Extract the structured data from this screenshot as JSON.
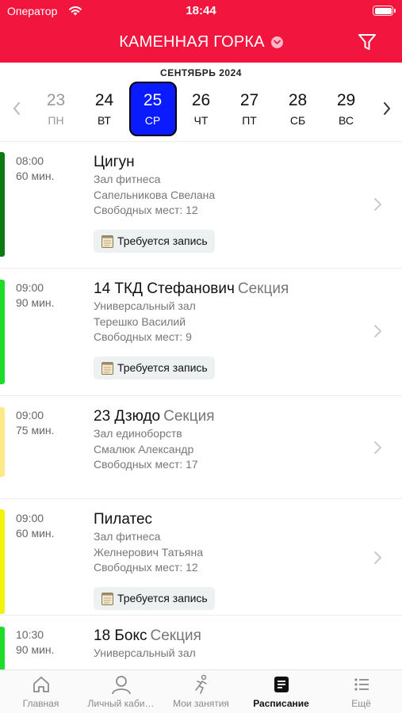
{
  "status_bar": {
    "carrier": "Оператор",
    "time": "18:44"
  },
  "header": {
    "title": "КАМЕННАЯ ГОРКА",
    "accent_color": "#f2163f"
  },
  "calendar": {
    "month": "СЕНТЯБРЬ 2024",
    "days": [
      {
        "num": "23",
        "weekday": "ПН",
        "state": "past"
      },
      {
        "num": "24",
        "weekday": "ВТ",
        "state": "normal"
      },
      {
        "num": "25",
        "weekday": "СР",
        "state": "selected"
      },
      {
        "num": "26",
        "weekday": "ЧТ",
        "state": "normal"
      },
      {
        "num": "27",
        "weekday": "ПТ",
        "state": "normal"
      },
      {
        "num": "28",
        "weekday": "СБ",
        "state": "normal"
      },
      {
        "num": "29",
        "weekday": "ВС",
        "state": "normal"
      }
    ],
    "selected_color": "#0b1bff"
  },
  "sessions": [
    {
      "time": "08:00",
      "duration": "60 мин.",
      "title": "Цигун",
      "kind": "",
      "hall": "Зал фитнеса",
      "trainer": "Сапельникова Свелана",
      "seats": "Свободных мест: 12",
      "badge": "Требуется запись",
      "color": "#0c7a12"
    },
    {
      "time": "09:00",
      "duration": "90 мин.",
      "title": "14 ТКД Стефанович",
      "kind": "Секция",
      "hall": "Универсальный зал",
      "trainer": "Терешко Василий",
      "seats": "Свободных мест: 9",
      "badge": "Требуется запись",
      "color": "#1edc2a"
    },
    {
      "time": "09:00",
      "duration": "75 мин.",
      "title": "23 Дзюдо",
      "kind": "Секция",
      "hall": "Зал единоборств",
      "trainer": "Смалюк Александр",
      "seats": "Свободных мест: 17",
      "badge": "",
      "color": "#ffe88a"
    },
    {
      "time": "09:00",
      "duration": "60 мин.",
      "title": "Пилатес",
      "kind": "",
      "hall": "Зал фитнеса",
      "trainer": "Желнерович Татьяна",
      "seats": "Свободных мест: 12",
      "badge": "Требуется запись",
      "color": "#f2f20a"
    },
    {
      "time": "10:30",
      "duration": "90 мин.",
      "title": "18 Бокс",
      "kind": "Секция",
      "hall": "Универсальный зал",
      "trainer": "",
      "seats": "",
      "badge": "",
      "color": "#1edc2a"
    }
  ],
  "tabbar": {
    "items": [
      {
        "label": "Главная",
        "icon": "home-icon",
        "active": false
      },
      {
        "label": "Личный каби…",
        "icon": "person-icon",
        "active": false
      },
      {
        "label": "Мои занятия",
        "icon": "runner-icon",
        "active": false
      },
      {
        "label": "Расписание",
        "icon": "schedule-icon",
        "active": true
      },
      {
        "label": "Ещё",
        "icon": "list-icon",
        "active": false
      }
    ]
  }
}
